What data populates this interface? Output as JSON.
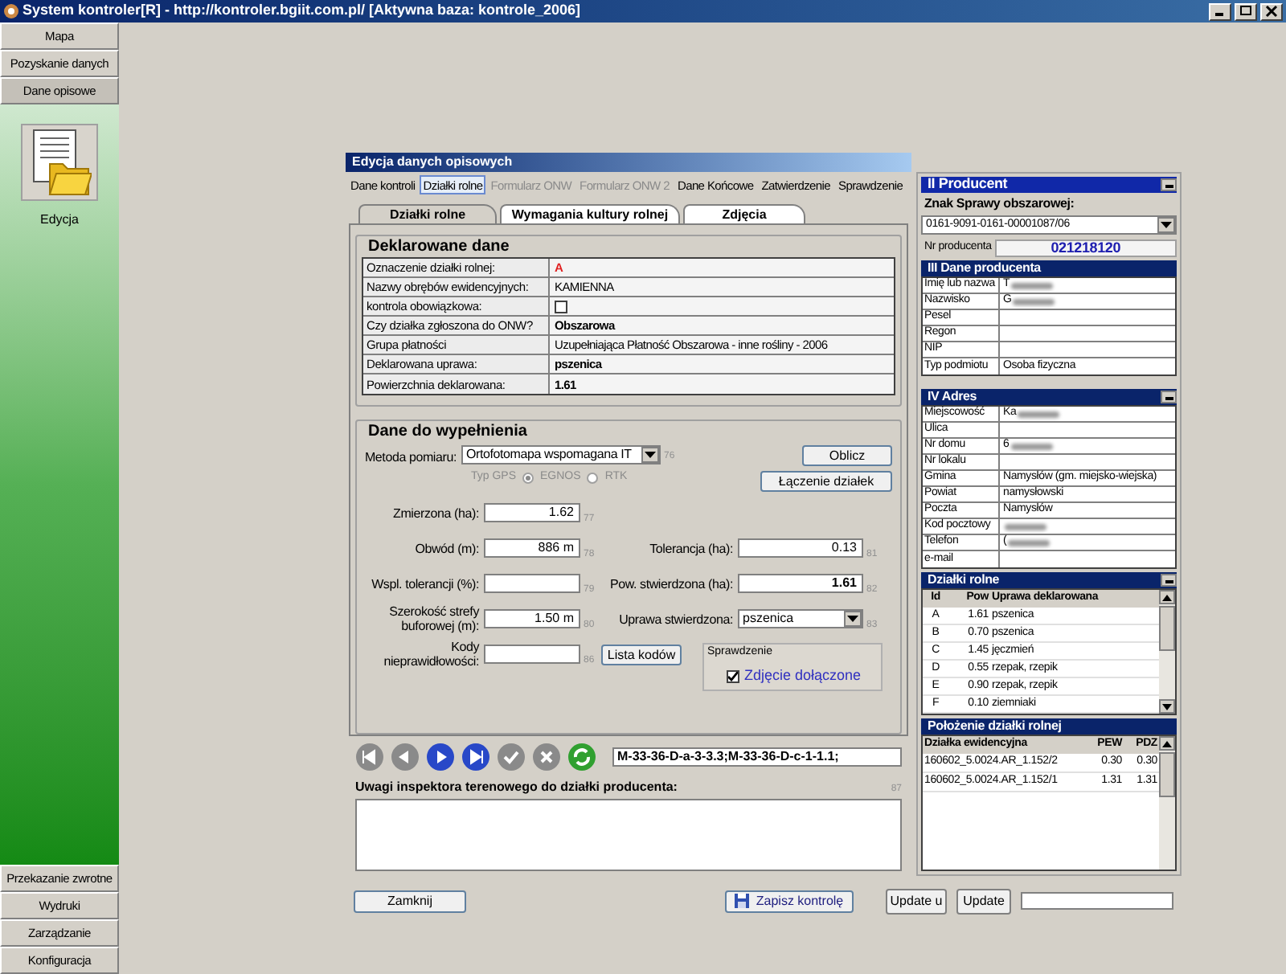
{
  "window": {
    "title": "System kontroler[R] - http://kontroler.bgiit.com.pl/ [Aktywna baza: kontrole_2006]"
  },
  "sidebar": {
    "top_items": [
      {
        "label": "Mapa",
        "selected": false
      },
      {
        "label": "Pozyskanie danych",
        "selected": false
      },
      {
        "label": "Dane opisowe",
        "selected": true
      }
    ],
    "panel_item": {
      "label": "Edycja"
    },
    "bottom_items": [
      {
        "label": "Przekazanie zwrotne"
      },
      {
        "label": "Wydruki"
      },
      {
        "label": "Zarządzanie"
      },
      {
        "label": "Konfiguracja"
      }
    ]
  },
  "dialog": {
    "title": "Edycja danych opisowych",
    "menu": [
      {
        "label": "Dane kontroli",
        "selected": false,
        "disabled": false
      },
      {
        "label": "Działki rolne",
        "selected": true,
        "disabled": false
      },
      {
        "label": "Formularz ONW",
        "selected": false,
        "disabled": true
      },
      {
        "label": "Formularz ONW 2",
        "selected": false,
        "disabled": true
      },
      {
        "label": "Dane Końcowe",
        "selected": false,
        "disabled": false
      },
      {
        "label": "Zatwierdzenie",
        "selected": false,
        "disabled": false
      },
      {
        "label": "Sprawdzenie",
        "selected": false,
        "disabled": false
      }
    ],
    "tabs": [
      {
        "label": "Działki rolne",
        "selected": true
      },
      {
        "label": "Wymagania kultury rolnej",
        "selected": false
      },
      {
        "label": "Zdjęcia",
        "selected": false
      }
    ],
    "declared": {
      "title": "Deklarowane dane",
      "rows": [
        {
          "label": "Oznaczenie działki rolnej:",
          "kind": "flag",
          "value": "A"
        },
        {
          "label": "Nazwy obrębów ewidencyjnych:",
          "kind": "text",
          "value": "KAMIENNA"
        },
        {
          "label": "kontrola obowiązkowa:",
          "kind": "checkbox",
          "checked": false
        },
        {
          "label": "Czy działka zgłoszona do ONW?",
          "kind": "bold",
          "value": "Obszarowa"
        },
        {
          "label": "Grupa płatności",
          "kind": "text",
          "value": "Uzupełniająca Płatność Obszarowa - inne rośliny - 2006"
        },
        {
          "label": "Deklarowana uprawa:",
          "kind": "bold",
          "value": "pszenica"
        },
        {
          "label": "Powierzchnia deklarowana:",
          "kind": "bold",
          "value": "1.61"
        }
      ]
    },
    "fill": {
      "title": "Dane do wypełnienia",
      "method": {
        "label": "Metoda pomiaru:",
        "value": "Ortofotomapa wspomagana IT",
        "number": "76"
      },
      "gps": {
        "label": "Typ GPS",
        "disabled": true,
        "options": [
          {
            "label": "EGNOS",
            "selected": true
          },
          {
            "label": "RTK",
            "selected": false
          }
        ]
      },
      "buttons": [
        "Oblicz",
        "Łączenie działek"
      ],
      "left_fields": [
        {
          "label": "Zmierzona (ha):",
          "value": "1.62",
          "number": "77"
        },
        {
          "label": "Obwód (m):",
          "value": "886 m",
          "number": "78"
        },
        {
          "label": "Wspl. tolerancji (%):",
          "number": "79"
        },
        {
          "label": "Szerokość strefy buforowej (m):",
          "value": "1.50 m",
          "number": "80"
        },
        {
          "label": "Kody nieprawidłowości:",
          "number": "86"
        }
      ],
      "codes_button": "Lista kodów",
      "right_fields": [
        {
          "label": "Tolerancja (ha):",
          "kind": "input",
          "value": "0.13",
          "number": "81",
          "bold": false
        },
        {
          "label": "Pow. stwierdzona (ha):",
          "kind": "input",
          "value": "1.61",
          "number": "82",
          "bold": true
        },
        {
          "label": "Uprawa stwierdzona:",
          "kind": "select",
          "value": "pszenica",
          "number": "83"
        }
      ],
      "check_group": {
        "title": "Sprawdzenie",
        "label": "Zdjęcie dołączone",
        "checked": true
      }
    },
    "nav": [
      {
        "kind": "first",
        "disabled": true
      },
      {
        "kind": "prev",
        "disabled": true
      },
      {
        "kind": "next",
        "disabled": false
      },
      {
        "kind": "last",
        "disabled": false
      },
      {
        "kind": "ok",
        "disabled": true
      },
      {
        "kind": "cancel",
        "disabled": true
      },
      {
        "kind": "refresh",
        "disabled": false
      }
    ],
    "map_sheets": "M-33-36-D-a-3-3.3;M-33-36-D-c-1-1.1;",
    "notes": {
      "label": "Uwagi inspektora terenowego do działki producenta:",
      "number": "87"
    },
    "footer": {
      "close": "Zamknij",
      "save": "Zapisz kontrolę",
      "update_u": "Update u",
      "update": "Update"
    }
  },
  "producer": {
    "title": "II Producent",
    "case_label": "Znak Sprawy obszarowej:",
    "case_value": "0161-9091-0161-00001087/06",
    "number_label": "Nr producenta",
    "number_value": "021218120",
    "details": {
      "title": "III  Dane producenta",
      "rows": [
        {
          "label": "Imię lub nazwa",
          "value": "T",
          "redacted": true
        },
        {
          "label": "Nazwisko",
          "value": "G",
          "redacted": true
        },
        {
          "label": "Pesel"
        },
        {
          "label": "Regon"
        },
        {
          "label": "NIP"
        },
        {
          "label": "Typ podmiotu",
          "value": "Osoba fizyczna"
        }
      ]
    },
    "address": {
      "title": "IV Adres",
      "rows": [
        {
          "label": "Miejscowość",
          "value": "Ka",
          "redacted": true
        },
        {
          "label": "Ulica"
        },
        {
          "label": "Nr domu",
          "value": "6",
          "redacted": true
        },
        {
          "label": "Nr lokalu"
        },
        {
          "label": "Gmina",
          "value": "Namysłów (gm. miejsko-wiejska)"
        },
        {
          "label": "Powiat",
          "value": "namysłowski"
        },
        {
          "label": "Poczta",
          "value": "Namysłów"
        },
        {
          "label": "Kod pocztowy",
          "redacted": true
        },
        {
          "label": "Telefon",
          "value": "(",
          "redacted": true
        },
        {
          "label": "e-mail"
        }
      ]
    },
    "plots": {
      "title": "Działki rolne",
      "columns": [
        "Id",
        "Pow",
        "Uprawa deklarowana"
      ],
      "rows": [
        [
          "A",
          "1.61",
          "pszenica"
        ],
        [
          "B",
          "0.70",
          "pszenica"
        ],
        [
          "C",
          "1.45",
          "jęczmień"
        ],
        [
          "D",
          "0.55",
          "rzepak, rzepik"
        ],
        [
          "E",
          "0.90",
          "rzepak, rzepik"
        ],
        [
          "F",
          "0.10",
          "ziemniaki"
        ]
      ]
    },
    "location": {
      "title": "Położenie działki rolnej",
      "columns": [
        "Działka ewidencyjna",
        "PEW",
        "PDZ"
      ],
      "rows": [
        [
          "160602_5.0024.AR_1.152/2",
          "0.30",
          "0.30"
        ],
        [
          "160602_5.0024.AR_1.152/1",
          "1.31",
          "1.31"
        ]
      ]
    }
  }
}
